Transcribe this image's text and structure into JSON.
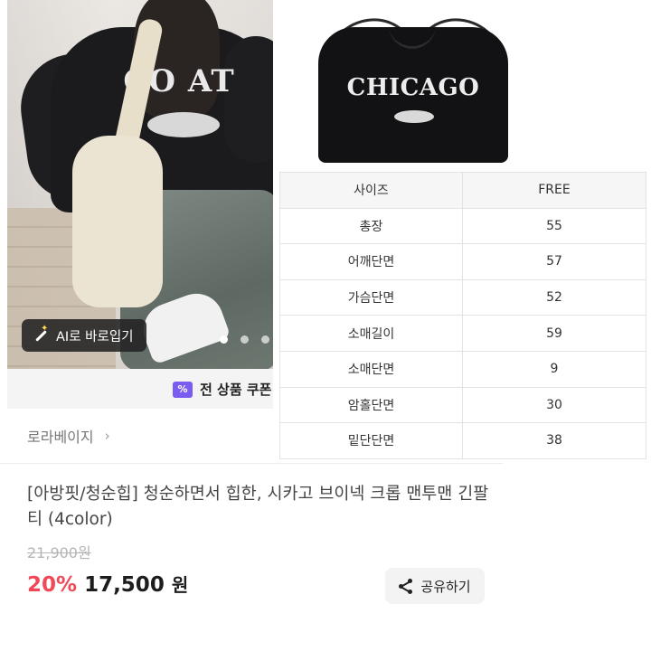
{
  "photo": {
    "ai_button_label": "AI로 바로입기",
    "print_text": "CO AT",
    "carousel": {
      "total_dots": 3,
      "active_index": 0
    }
  },
  "coupon": {
    "label": "전 상품 쿠폰",
    "icon": "coupon-icon",
    "icon_glyph": "%"
  },
  "thumbnail2": {
    "logo_text": "CHICAGO"
  },
  "size_table": {
    "headers": [
      "사이즈",
      "FREE"
    ],
    "rows": [
      [
        "총장",
        "55"
      ],
      [
        "어깨단면",
        "57"
      ],
      [
        "가슴단면",
        "52"
      ],
      [
        "소매길이",
        "59"
      ],
      [
        "소매단면",
        "9"
      ],
      [
        "암홀단면",
        "30"
      ],
      [
        "밑단단면",
        "38"
      ]
    ]
  },
  "brand": {
    "name": "로라베이지",
    "chevron": "›"
  },
  "product": {
    "title": "[아방핏/청순힙] 청순하면서 힙한, 시카고 브이넥 크롭 맨투맨 긴팔티 (4color)",
    "original_price": "21,900원",
    "discount": "20%",
    "price": "17,500",
    "currency": "원"
  },
  "share": {
    "label": "공유하기",
    "icon": "share-icon"
  },
  "colors": {
    "discount": "#f04856",
    "coupon_icon": "#7b5cf0"
  }
}
